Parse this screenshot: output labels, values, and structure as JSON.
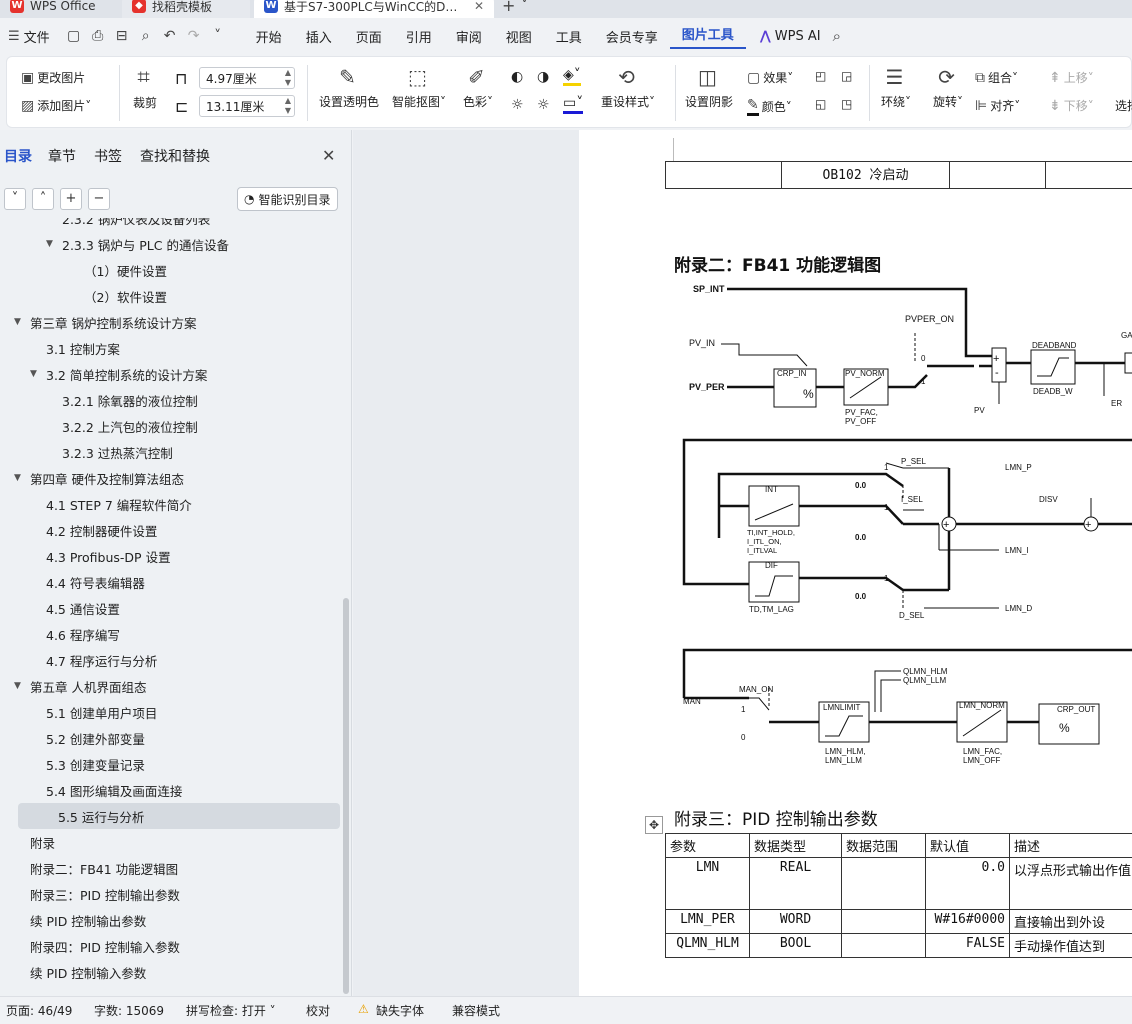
{
  "tabs": [
    {
      "label": "WPS Office",
      "icon": "W",
      "color": "#e5322d"
    },
    {
      "label": "找稻壳模板",
      "icon": "◆",
      "color": "#e5322d"
    },
    {
      "label": "基于S7-300PLC与WinCC的D…",
      "icon": "W",
      "color": "#2a55c9"
    }
  ],
  "menubar": {
    "file": "文件",
    "items": [
      "开始",
      "插入",
      "页面",
      "引用",
      "审阅",
      "视图",
      "工具",
      "会员专享",
      "图片工具"
    ],
    "wps_ai": "WPS AI"
  },
  "ribbon": {
    "change_pic": "更改图片",
    "add_pic": "添加图片",
    "crop": "裁剪",
    "width": "4.97厘米",
    "height": "13.11厘米",
    "transparent": "设置透明色",
    "smart_cut": "智能抠图",
    "color": "色彩",
    "reset_style": "重设样式",
    "shadow": "设置阴影",
    "effect": "效果",
    "fill_color": "颜色",
    "wrap": "环绕",
    "rotate": "旋转",
    "group": "组合",
    "align": "对齐",
    "move_up": "上移",
    "move_down": "下移",
    "select": "选择"
  },
  "sidebar": {
    "tabs": [
      "目录",
      "章节",
      "书签",
      "查找和替换"
    ],
    "smart_toc": "智能识别目录",
    "toc": [
      {
        "label": "2.3.2 锅炉仪表及设备列表",
        "level": 3,
        "tw": ""
      },
      {
        "label": "2.3.3 锅炉与 PLC 的通信设备",
        "level": 2,
        "tw": "▼"
      },
      {
        "label": "（1）硬件设置",
        "level": 4,
        "tw": ""
      },
      {
        "label": "（2）软件设置",
        "level": 4,
        "tw": ""
      },
      {
        "label": "第三章 锅炉控制系统设计方案",
        "level": 0,
        "tw": "▼"
      },
      {
        "label": "3.1 控制方案",
        "level": 1,
        "tw": ""
      },
      {
        "label": "3.2 简单控制系统的设计方案",
        "level": 1,
        "tw": "▼"
      },
      {
        "label": "3.2.1 除氧器的液位控制",
        "level": 3,
        "tw": ""
      },
      {
        "label": "3.2.2 上汽包的液位控制",
        "level": 3,
        "tw": ""
      },
      {
        "label": "3.2.3 过热蒸汽控制",
        "level": 3,
        "tw": ""
      },
      {
        "label": "第四章 硬件及控制算法组态",
        "level": 0,
        "tw": "▼"
      },
      {
        "label": "4.1 STEP 7 编程软件简介",
        "level": 1,
        "tw": ""
      },
      {
        "label": "4.2 控制器硬件设置",
        "level": 1,
        "tw": ""
      },
      {
        "label": "4.3 Profibus-DP 设置",
        "level": 1,
        "tw": ""
      },
      {
        "label": "4.4 符号表编辑器",
        "level": 1,
        "tw": ""
      },
      {
        "label": "4.5 通信设置",
        "level": 1,
        "tw": ""
      },
      {
        "label": "4.6 程序编写",
        "level": 1,
        "tw": ""
      },
      {
        "label": "4.7 程序运行与分析",
        "level": 1,
        "tw": ""
      },
      {
        "label": "第五章 人机界面组态",
        "level": 0,
        "tw": "▼"
      },
      {
        "label": "5.1 创建单用户项目",
        "level": 1,
        "tw": ""
      },
      {
        "label": "5.2 创建外部变量",
        "level": 1,
        "tw": ""
      },
      {
        "label": "5.3 创建变量记录",
        "level": 1,
        "tw": ""
      },
      {
        "label": "5.4 图形编辑及画面连接",
        "level": 1,
        "tw": ""
      },
      {
        "label": "5.5 运行与分析",
        "level": 1,
        "tw": "",
        "selected": true
      },
      {
        "label": "附录",
        "level": 5,
        "tw": ""
      },
      {
        "label": "附录二：FB41 功能逻辑图",
        "level": 5,
        "tw": ""
      },
      {
        "label": "附录三：PID 控制输出参数",
        "level": 5,
        "tw": ""
      },
      {
        "label": "续 PID 控制输出参数",
        "level": 5,
        "tw": ""
      },
      {
        "label": "附录四：PID 控制输入参数",
        "level": 5,
        "tw": ""
      },
      {
        "label": "续 PID 控制输入参数",
        "level": 5,
        "tw": ""
      }
    ]
  },
  "document": {
    "top_table_cell": "OB102 冷启动",
    "appendix2_title": "附录二：FB41 功能逻辑图",
    "appendix3_title": "附录三：PID 控制输出参数",
    "param_table": {
      "headers": [
        "参数",
        "数据类型",
        "数据范围",
        "默认值",
        "描述"
      ],
      "rows": [
        [
          "LMN",
          "REAL",
          "",
          "0.0",
          "以浮点形式输出作值"
        ],
        [
          "LMN_PER",
          "WORD",
          "",
          "W#16#0000",
          "直接输出到外设"
        ],
        [
          "QLMN_HLM",
          "BOOL",
          "",
          "FALSE",
          "手动操作值达到"
        ]
      ]
    },
    "diagram": {
      "sp_int": "SP_INT",
      "pv_in": "PV_IN",
      "pv_per": "PV_PER",
      "pvper_on": "PVPER_ON",
      "crp_in": "CRP_IN",
      "pv_norm": "PV_NORM",
      "pv_fac": "PV_FAC,",
      "pv_off": "PV_OFF",
      "deadband": "DEADBAND",
      "deadb_w": "DEADB_W",
      "ga": "GA",
      "pv": "PV",
      "er": "ER",
      "p_sel": "P_SEL",
      "i_sel": "I_SEL",
      "d_sel": "D_SEL",
      "lmn_p": "LMN_P",
      "lmn_i": "LMN_I",
      "lmn_d": "LMN_D",
      "disv": "DISV",
      "int": "INT",
      "ti": "TI,INT_HOLD,",
      "itl_on": "I_ITL_ON,",
      "itlval": "I_ITLVAL",
      "dif": "DIF",
      "td": "TD,TM_LAG",
      "man": "MAN",
      "man_on": "MAN_ON",
      "qlmn_hlm": "QLMN_HLM",
      "qlmn_llm": "QLMN_LLM",
      "lmnlimit": "LMNLIMIT",
      "lmn_hlm": "LMN_HLM,",
      "lmn_llm": "LMN_LLM",
      "lmn_norm": "LMN_NORM",
      "lmn_fac": "LMN_FAC,",
      "lmn_off": "LMN_OFF",
      "crp_out": "CRP_OUT",
      "zero": "0.0",
      "one": "1",
      "o": "0",
      "pct": "%"
    }
  },
  "status": {
    "page": "页面: 46/49",
    "words": "字数: 15069",
    "spell": "拼写检查: 打开",
    "proof": "校对",
    "missing_font": "缺失字体",
    "compat": "兼容模式"
  }
}
